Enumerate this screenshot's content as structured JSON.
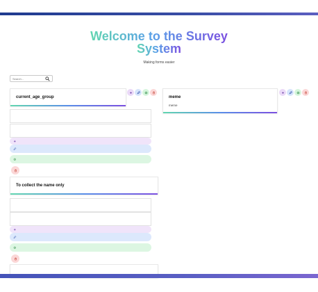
{
  "header": {
    "title_line1": "Welcome to the Survey",
    "title_line2": "System",
    "subtitle": "Making forms easier"
  },
  "search": {
    "placeholder": "Search..."
  },
  "cards": [
    {
      "title": "current_age_group",
      "description": ""
    },
    {
      "title": "meme",
      "description": "meme"
    },
    {
      "title": "To collect the name only",
      "description": ""
    }
  ],
  "icons": {
    "add": "plus-icon",
    "edit": "pencil-icon",
    "view": "eye-icon",
    "delete": "trash-icon",
    "search": "search-icon"
  },
  "colors": {
    "accent_gradient": [
      "#62d6b0",
      "#5a8ee8",
      "#7b4fe0"
    ],
    "add_bg": "#ead9f7",
    "edit_bg": "#d6e4fb",
    "view_bg": "#d6f5dd",
    "delete_bg": "#fbd7d7",
    "top_bar": "#2a3f95"
  }
}
